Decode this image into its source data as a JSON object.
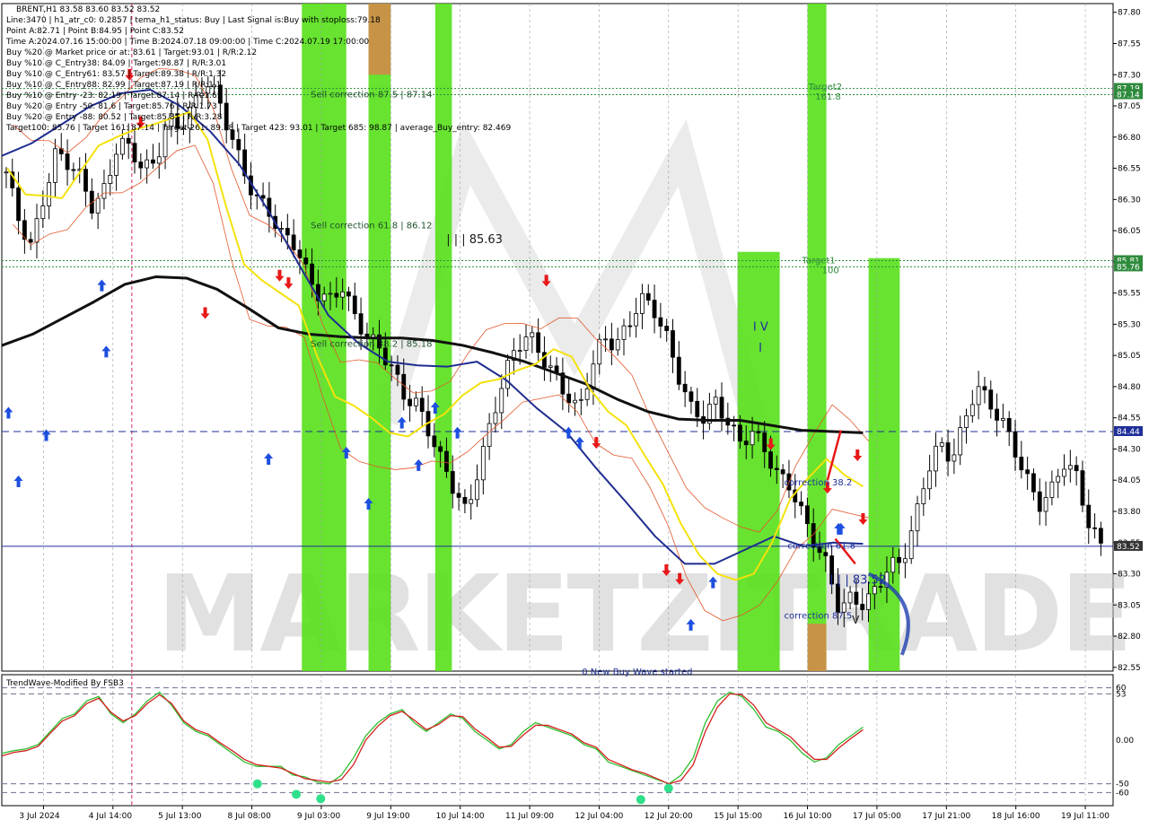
{
  "chart_data": {
    "type": "candlestick",
    "symbol_header": "BRENT,H1  83.58 83.60 83.52 83.52",
    "overlay_lines": [
      "Line:3470 | h1_atr_c0: 0.2857 | tema_h1_status: Buy | Last Signal is:Buy with stoploss:79.18",
      "Point A:82.71 | Point B:84.95 | Point C:83.52",
      "Time A:2024.07.16 15:00:00 | Time B:2024.07.18 09:00:00 | Time C:2024.07.19 17:00:00",
      "Buy %20 @ Market price or at: 83.61 | Target:93.01 | R/R:2.12",
      "Buy %10 @ C_Entry38: 84.09 | Target:98.87 | R/R:3.01",
      "Buy %10 @ C_Entry61: 83.57 | Target:89.38 | R/R:1.32",
      "Buy %10 @ C_Entry88: 82.99 | Target:87.19 | R/R:1.1",
      "Buy %10 @ Entry -23: 82.19 | Target:87.14 | R/R:1.65",
      "Buy %20 @ Entry -50: 81.6 | Target:85.76 | R/R:1.73",
      "Buy %20 @ Entry -88: 80.52 | Target:85.81 | R/R:3.28",
      "Target100: 85.76 | Target 161: 87.14 | Target 261: 89.38 | Target 423: 93.01 | Target 685: 98.87 | average_Buy_entry: 82.469"
    ],
    "y_axis_ticks": [
      "87.80",
      "87.55",
      "87.30",
      "87.05",
      "86.80",
      "86.55",
      "86.30",
      "86.05",
      "85.80",
      "85.55",
      "85.30",
      "85.05",
      "84.80",
      "84.55",
      "84.30",
      "84.05",
      "83.80",
      "83.55",
      "83.30",
      "83.05",
      "82.80",
      "82.55"
    ],
    "ylim": [
      82.52,
      87.87
    ],
    "x_axis_ticks": [
      "3 Jul 2024",
      "4 Jul 14:00",
      "5 Jul 13:00",
      "8 Jul 08:00",
      "9 Jul 03:00",
      "9 Jul 19:00",
      "10 Jul 14:00",
      "11 Jul 09:00",
      "12 Jul 04:00",
      "12 Jul 20:00",
      "15 Jul 15:00",
      "16 Jul 10:00",
      "17 Jul 05:00",
      "17 Jul 21:00",
      "18 Jul 16:00",
      "19 Jul 11:00"
    ],
    "price_labels": [
      {
        "text": "87.19",
        "value": 87.19,
        "color": "#2e8b3c"
      },
      {
        "text": "87.14",
        "value": 87.14,
        "color": "#2e8b3c"
      },
      {
        "text": "85.81",
        "value": 85.81,
        "color": "#2e8b3c"
      },
      {
        "text": "85.76",
        "value": 85.76,
        "color": "#2e8b3c"
      },
      {
        "text": "84.44",
        "value": 84.44,
        "color": "#1f2f9a"
      },
      {
        "text": "83.52",
        "value": 83.52,
        "color": "#333333"
      }
    ],
    "horizontal_lines": [
      {
        "value": 87.19,
        "color": "#2e8b3c",
        "style": "dotted"
      },
      {
        "value": 87.14,
        "color": "#2e8b3c",
        "style": "dotted"
      },
      {
        "value": 85.81,
        "color": "#2e8b3c",
        "style": "dotted"
      },
      {
        "value": 85.76,
        "color": "#2e8b3c",
        "style": "dotted"
      },
      {
        "value": 84.44,
        "color": "#1f2f9a",
        "style": "dashed"
      },
      {
        "value": 83.52,
        "color": "#1f2f9a",
        "style": "solid"
      }
    ],
    "zones": [
      {
        "from": 0.27,
        "to": 0.31,
        "color": "#56e01a",
        "ymin": 82.52
      },
      {
        "from": 0.33,
        "to": 0.35,
        "color": "#56e01a",
        "ymin": 82.52
      },
      {
        "from": 0.33,
        "to": 0.35,
        "color": "#d08a4a",
        "ymin": 87.3,
        "ymax": 87.87
      },
      {
        "from": 0.39,
        "to": 0.405,
        "color": "#56e01a",
        "ymin": 82.52
      },
      {
        "from": 0.662,
        "to": 0.7,
        "color": "#56e01a",
        "ymin": 82.52,
        "ymax": 85.88
      },
      {
        "from": 0.725,
        "to": 0.742,
        "color": "#56e01a",
        "ymin": 82.52,
        "ymax": 87.87
      },
      {
        "from": 0.725,
        "to": 0.742,
        "color": "#d08a4a",
        "ymin": 82.52,
        "ymax": 82.9
      },
      {
        "from": 0.78,
        "to": 0.808,
        "color": "#56e01a",
        "ymin": 82.52,
        "ymax": 85.83
      }
    ],
    "annotations": [
      {
        "text": "Sell correction 87.5 | 87.14",
        "x": 0.278,
        "y": 87.12,
        "color": "#1f4f2a",
        "size": 10
      },
      {
        "text": "Sell correction 61.8 | 86.12",
        "x": 0.278,
        "y": 86.07,
        "color": "#1f4f2a",
        "size": 10
      },
      {
        "text": "Sell correction 38.2 | 85.18",
        "x": 0.278,
        "y": 85.12,
        "color": "#1f4f2a",
        "size": 10
      },
      {
        "text": "| | | 85.63",
        "x": 0.4,
        "y": 85.95,
        "color": "#1a1a1a",
        "size": 13
      },
      {
        "text": "Target2",
        "x": 0.726,
        "y": 87.18,
        "color": "#2e8b3c",
        "size": 10
      },
      {
        "text": "161.8",
        "x": 0.732,
        "y": 87.1,
        "color": "#2e8b3c",
        "size": 10
      },
      {
        "text": "Target1",
        "x": 0.72,
        "y": 85.79,
        "color": "#2e8b3c",
        "size": 10
      },
      {
        "text": "100",
        "x": 0.738,
        "y": 85.71,
        "color": "#2e8b3c",
        "size": 10
      },
      {
        "text": "I V",
        "x": 0.676,
        "y": 85.25,
        "color": "#1f2f9a",
        "size": 13
      },
      {
        "text": "I",
        "x": 0.681,
        "y": 85.08,
        "color": "#1f2f9a",
        "size": 13
      },
      {
        "text": "correction 38.2",
        "x": 0.704,
        "y": 84.01,
        "color": "#1f2f9a",
        "size": 10
      },
      {
        "text": "correction 61.8",
        "x": 0.707,
        "y": 83.5,
        "color": "#1f2f9a",
        "size": 10
      },
      {
        "text": "| | | 83.52",
        "x": 0.745,
        "y": 83.22,
        "color": "#1f2f9a",
        "size": 13
      },
      {
        "text": "correction 87.5",
        "x": 0.704,
        "y": 82.94,
        "color": "#1f2f9a",
        "size": 10
      },
      {
        "text": "V",
        "x": 0.765,
        "y": 82.9,
        "color": "#1a1a1a",
        "size": 12
      },
      {
        "text": "0 New Buy Wave started",
        "x": 0.522,
        "y": 82.49,
        "color": "#1f2f9a",
        "size": 10
      }
    ],
    "ohlc_close_path": [
      86.52,
      86.14,
      85.92,
      86.31,
      86.68,
      86.59,
      86.47,
      86.22,
      86.4,
      86.76,
      86.71,
      86.54,
      86.6,
      86.95,
      86.88,
      87.04,
      87.26,
      87.12,
      86.83,
      86.55,
      86.31,
      86.24,
      86.02,
      85.98,
      85.74,
      85.55,
      85.49,
      85.61,
      85.36,
      85.2,
      85.11,
      84.95,
      84.72,
      84.66,
      84.44,
      84.2,
      83.98,
      83.78,
      84.16,
      84.52,
      84.88,
      85.12,
      85.22,
      85.05,
      84.9,
      84.74,
      84.6,
      84.94,
      85.2,
      85.13,
      85.29,
      85.51,
      85.43,
      85.22,
      84.9,
      84.63,
      84.55,
      84.68,
      84.52,
      84.35,
      84.44,
      84.29,
      84.09,
      84.01,
      83.77,
      83.55,
      83.36,
      83.0,
      83.12,
      83.04,
      83.2,
      83.36,
      83.4,
      83.7,
      84.12,
      84.34,
      84.22,
      84.5,
      84.82,
      84.66,
      84.54,
      84.31,
      84.07,
      83.85,
      83.96,
      84.2,
      84.09,
      83.71,
      83.52
    ],
    "yellow_ma": [
      86.55,
      86.34,
      86.33,
      86.31,
      86.52,
      86.73,
      86.8,
      86.86,
      86.9,
      86.95,
      87.0,
      86.78,
      86.25,
      85.78,
      85.65,
      85.55,
      85.45,
      85.05,
      84.72,
      84.65,
      84.55,
      84.43,
      84.4,
      84.5,
      84.58,
      84.73,
      84.83,
      84.86,
      84.93,
      84.98,
      85.1,
      85.04,
      84.78,
      84.6,
      84.49,
      84.25,
      84.02,
      83.7,
      83.45,
      83.3,
      83.25,
      83.3,
      83.55,
      83.9,
      84.07,
      84.22,
      84.09,
      84.0
    ],
    "blue_ma": [
      86.65,
      86.75,
      86.9,
      87.05,
      87.15,
      87.18,
      87.05,
      86.85,
      86.58,
      86.2,
      85.78,
      85.37,
      85.15,
      85.0,
      84.97,
      84.96,
      85.0,
      84.85,
      84.63,
      84.44,
      84.15,
      83.88,
      83.6,
      83.38,
      83.38,
      83.49,
      83.6,
      83.52,
      83.55,
      83.54
    ],
    "black_ma": [
      85.13,
      85.22,
      85.35,
      85.48,
      85.62,
      85.68,
      85.67,
      85.58,
      85.43,
      85.27,
      85.22,
      85.2,
      85.19,
      85.19,
      85.17,
      85.13,
      85.07,
      85.0,
      84.91,
      84.82,
      84.7,
      84.6,
      84.54,
      84.53,
      84.53,
      84.49,
      84.45,
      84.44,
      84.43
    ],
    "buy_arrows": [
      [
        0.006,
        84.58
      ],
      [
        0.015,
        84.03
      ],
      [
        0.04,
        84.4
      ],
      [
        0.09,
        85.6
      ],
      [
        0.094,
        85.07
      ],
      [
        0.24,
        84.21
      ],
      [
        0.31,
        84.26
      ],
      [
        0.33,
        83.85
      ],
      [
        0.36,
        84.5
      ],
      [
        0.375,
        84.16
      ],
      [
        0.39,
        84.62
      ],
      [
        0.41,
        84.42
      ],
      [
        0.51,
        84.42
      ],
      [
        0.52,
        84.34
      ],
      [
        0.62,
        82.88
      ],
      [
        0.64,
        83.22
      ],
      [
        0.753,
        83.65
      ],
      [
        0.755,
        83.65
      ]
    ],
    "sell_arrows": [
      [
        0.115,
        87.31
      ],
      [
        0.125,
        86.93
      ],
      [
        0.183,
        85.4
      ],
      [
        0.25,
        85.7
      ],
      [
        0.258,
        85.64
      ],
      [
        0.49,
        85.66
      ],
      [
        0.535,
        84.36
      ],
      [
        0.598,
        83.34
      ],
      [
        0.61,
        83.27
      ],
      [
        0.692,
        84.35
      ],
      [
        0.743,
        84.0
      ],
      [
        0.77,
        84.26
      ],
      [
        0.775,
        83.75
      ]
    ],
    "indicator": {
      "name": "TrendWave-Modified By FSB3",
      "ticks": [
        "60",
        "53",
        "0.00",
        "-50",
        "-60"
      ],
      "ylim": [
        -75,
        75
      ],
      "levels": [
        60,
        53,
        -50,
        -60
      ],
      "green_line": [
        -15,
        -12,
        -10,
        -5,
        10,
        25,
        30,
        45,
        50,
        30,
        20,
        30,
        45,
        55,
        40,
        20,
        10,
        5,
        -5,
        -15,
        -25,
        -30,
        -30,
        -30,
        -40,
        -42,
        -48,
        -50,
        -40,
        -20,
        5,
        20,
        30,
        35,
        20,
        10,
        20,
        30,
        25,
        10,
        0,
        -10,
        -5,
        10,
        20,
        15,
        10,
        5,
        -5,
        -10,
        -25,
        -30,
        -35,
        -40,
        -45,
        -50,
        -40,
        -20,
        20,
        45,
        55,
        50,
        35,
        15,
        10,
        0,
        -15,
        -25,
        -20,
        -5,
        5,
        15
      ],
      "red_line": [
        -18,
        -14,
        -12,
        -7,
        8,
        22,
        28,
        42,
        48,
        32,
        22,
        28,
        42,
        52,
        42,
        22,
        12,
        7,
        -3,
        -12,
        -22,
        -28,
        -30,
        -32,
        -38,
        -44,
        -46,
        -48,
        -45,
        -28,
        0,
        16,
        28,
        33,
        23,
        12,
        18,
        28,
        27,
        13,
        3,
        -8,
        -7,
        6,
        17,
        17,
        12,
        7,
        -3,
        -8,
        -22,
        -28,
        -34,
        -38,
        -44,
        -50,
        -46,
        -28,
        10,
        38,
        53,
        52,
        40,
        20,
        12,
        4,
        -10,
        -22,
        -22,
        -9,
        2,
        12
      ],
      "dots": [
        [
          0.23,
          -50
        ],
        [
          0.265,
          -62
        ],
        [
          0.287,
          -67
        ],
        [
          0.575,
          -68
        ],
        [
          0.6,
          -55
        ]
      ]
    }
  }
}
